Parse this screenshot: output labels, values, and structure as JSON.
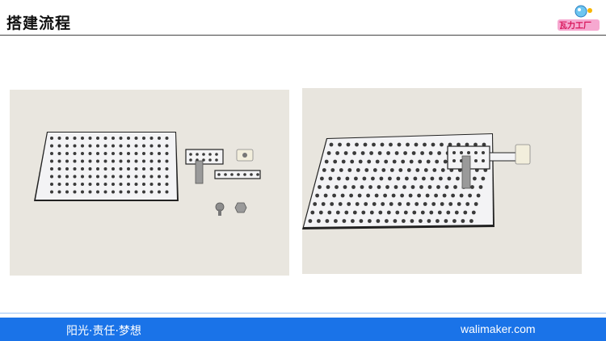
{
  "header": {
    "title": "搭建流程",
    "logo_text": "瓦力工厂"
  },
  "photos": {
    "left_alt": "parts laid out: perforated plate, bracket, small plates, screw and nut",
    "right_alt": "bracket assembled onto perforated plate"
  },
  "footer": {
    "slogan": "阳光·责任·梦想",
    "site": "walimaker.com",
    "bar_color": "#1a73e8"
  }
}
